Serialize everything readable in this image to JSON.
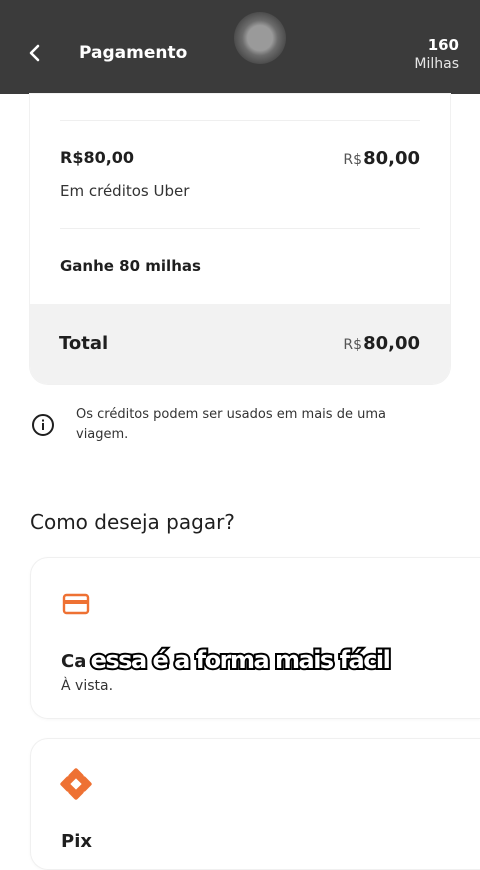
{
  "header": {
    "title": "Pagamento",
    "miles_count": "160",
    "miles_label": "Milhas"
  },
  "summary": {
    "credit_amount": "R$80,00",
    "price_currency": "R$",
    "price_value": "80,00",
    "credit_description": "Em créditos Uber",
    "miles_reward": "Ganhe 80 milhas",
    "total_label": "Total",
    "total_currency": "R$",
    "total_value": "80,00"
  },
  "info": {
    "text": "Os créditos podem ser usados em mais de uma viagem."
  },
  "payment": {
    "section_title": "Como deseja pagar?",
    "options": [
      {
        "title": "Ca",
        "subtitle": "À vista.",
        "icon": "credit-card-icon"
      },
      {
        "title": "Pix",
        "icon": "pix-icon"
      }
    ]
  },
  "caption": {
    "text": "essa é a forma mais fácil"
  },
  "colors": {
    "header_bg": "#3b3b3b",
    "accent_orange": "#ee7133",
    "total_band": "#f2f2f2"
  }
}
